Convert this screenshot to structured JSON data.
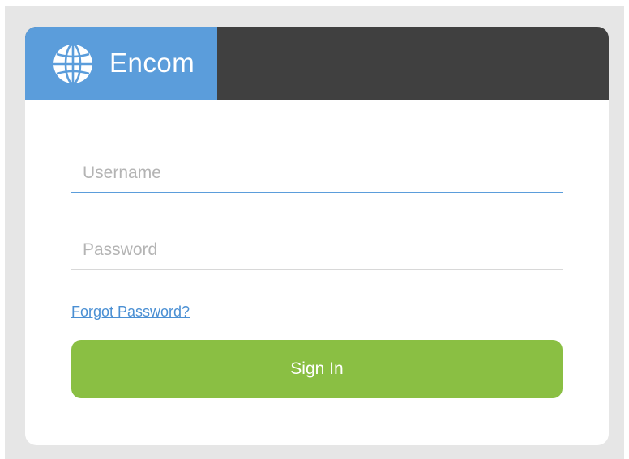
{
  "brand": {
    "name": "Encom",
    "icon": "globe-icon",
    "color": "#5b9ddb"
  },
  "header": {
    "color": "#404040"
  },
  "form": {
    "username": {
      "placeholder": "Username",
      "value": ""
    },
    "password": {
      "placeholder": "Password",
      "value": ""
    },
    "forgot_link": "Forgot Password?",
    "submit_label": "Sign In",
    "submit_color": "#8abf43"
  }
}
